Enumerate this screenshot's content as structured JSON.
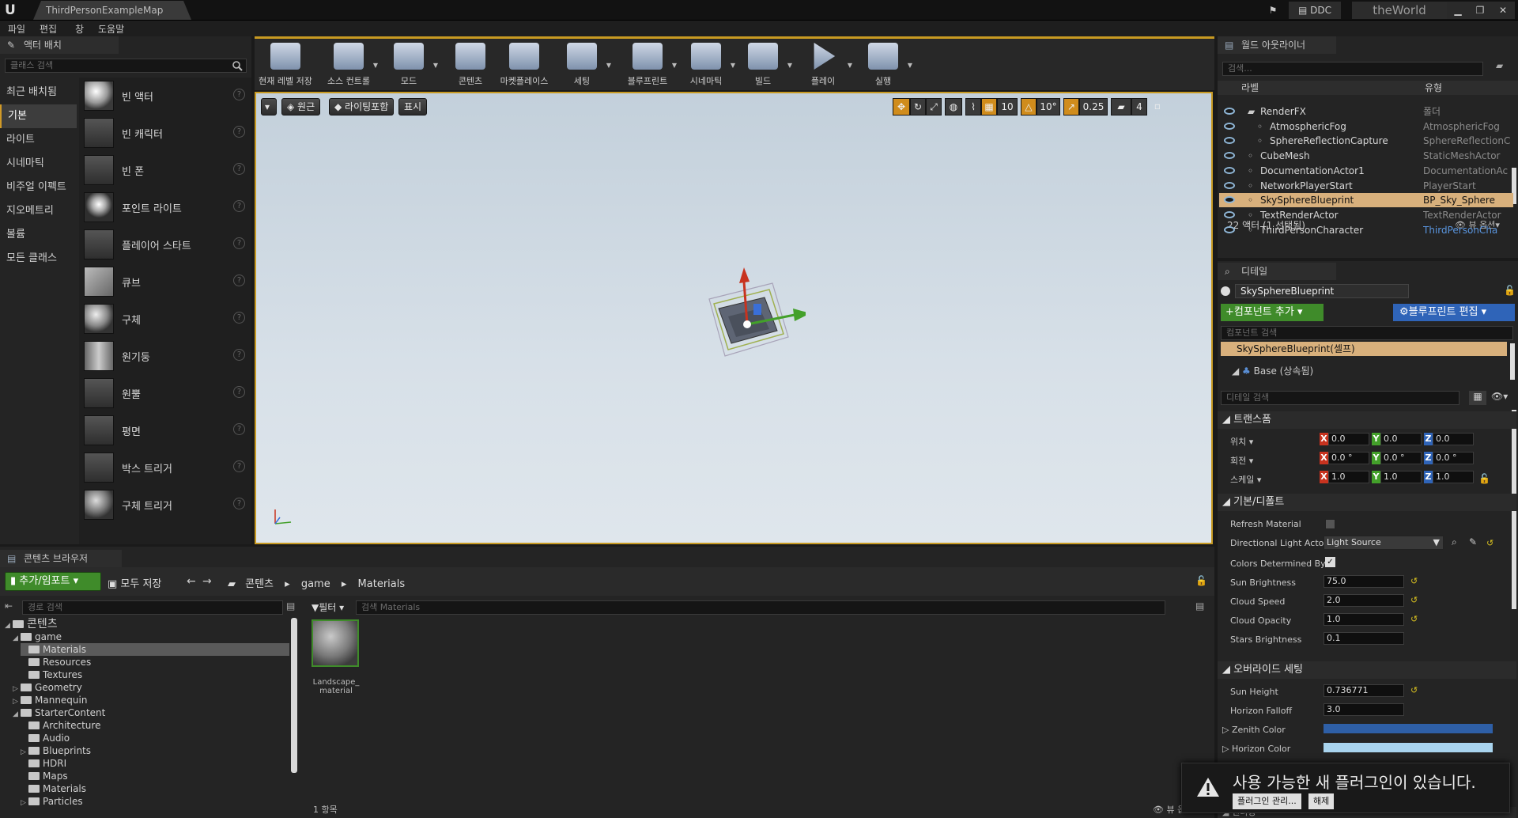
{
  "titlebar": {
    "map_tab": "ThirdPersonExampleMap",
    "ddc": "DDC",
    "world": "theWorld"
  },
  "menu": [
    "파일",
    "편집",
    "창",
    "도움말"
  ],
  "place": {
    "tab": "액터 배치",
    "search_placeholder": "클래스 검색",
    "categories": [
      "최근 배치됨",
      "기본",
      "라이트",
      "시네마틱",
      "비주얼 이펙트",
      "지오메트리",
      "볼륨",
      "모든 클래스"
    ],
    "items": [
      "빈 액터",
      "빈 캐릭터",
      "빈 폰",
      "포인트 라이트",
      "플레이어 스타트",
      "큐브",
      "구체",
      "원기둥",
      "원뿔",
      "평면",
      "박스 트리거",
      "구체 트리거"
    ]
  },
  "toolbar": [
    "현재 레벨 저장",
    "소스 컨트롤",
    "모드",
    "콘텐츠",
    "마켓플레이스",
    "세팅",
    "블루프린트",
    "시네마틱",
    "빌드",
    "플레이",
    "실행"
  ],
  "viewport": {
    "perspective": "원근",
    "lit": "라이팅포함",
    "show": "표시",
    "grid": "10",
    "angle": "10°",
    "scale": "0.25",
    "speed": "4"
  },
  "cb": {
    "tab": "콘텐츠 브라우저",
    "add": "추가/임포트",
    "save_all": "모두 저장",
    "path": [
      "콘텐츠",
      "game",
      "Materials"
    ],
    "path_search": "경로 검색",
    "filter": "필터",
    "asset_search": "검색 Materials",
    "tree": [
      {
        "label": "콘텐츠",
        "level": 0,
        "arrow": "◢"
      },
      {
        "label": "game",
        "level": 1,
        "arrow": "◢"
      },
      {
        "label": "Materials",
        "level": 2,
        "arrow": ""
      },
      {
        "label": "Resources",
        "level": 2,
        "arrow": ""
      },
      {
        "label": "Textures",
        "level": 2,
        "arrow": ""
      },
      {
        "label": "Geometry",
        "level": 1,
        "arrow": "▷"
      },
      {
        "label": "Mannequin",
        "level": 1,
        "arrow": "▷"
      },
      {
        "label": "StarterContent",
        "level": 1,
        "arrow": "◢"
      },
      {
        "label": "Architecture",
        "level": 2,
        "arrow": ""
      },
      {
        "label": "Audio",
        "level": 2,
        "arrow": ""
      },
      {
        "label": "Blueprints",
        "level": 2,
        "arrow": "▷"
      },
      {
        "label": "HDRI",
        "level": 2,
        "arrow": ""
      },
      {
        "label": "Maps",
        "level": 2,
        "arrow": ""
      },
      {
        "label": "Materials",
        "level": 2,
        "arrow": ""
      },
      {
        "label": "Particles",
        "level": 2,
        "arrow": "▷"
      }
    ],
    "asset": "Landscape_\nmaterial",
    "count": "1 항목",
    "view_options": "뷰 옵션"
  },
  "outliner": {
    "tab": "월드 아웃라이너",
    "search_placeholder": "검색...",
    "col_label": "라벨",
    "col_type": "유형",
    "rows": [
      {
        "name": "RenderFX",
        "type": "폴더",
        "indent": 0
      },
      {
        "name": "AtmosphericFog",
        "type": "AtmosphericFog",
        "indent": 1
      },
      {
        "name": "SphereReflectionCapture",
        "type": "SphereReflectionC",
        "indent": 1
      },
      {
        "name": "CubeMesh",
        "type": "StaticMeshActor",
        "indent": 0
      },
      {
        "name": "DocumentationActor1",
        "type": "DocumentationAc",
        "indent": 0
      },
      {
        "name": "NetworkPlayerStart",
        "type": "PlayerStart",
        "indent": 0
      },
      {
        "name": "SkySphereBlueprint",
        "type": "BP_Sky_Sphere",
        "indent": 0,
        "selected": true
      },
      {
        "name": "TextRenderActor",
        "type": "TextRenderActor",
        "indent": 0
      },
      {
        "name": "ThirdPersonCharacter",
        "type": "ThirdPersonCha",
        "indent": 0
      }
    ],
    "status": "22 액터 (1 선택됨)",
    "view_options": "뷰 옵션"
  },
  "details": {
    "tab": "디테일",
    "name": "SkySphereBlueprint",
    "add_component": "컴포넌트 추가",
    "edit_bp": "블루프린트 편집",
    "comp_search": "컴포넌트 검색",
    "self": "SkySphereBlueprint(셀프)",
    "base": "Base (상속됨)",
    "detail_search": "디테일 검색",
    "transform": "트랜스폼",
    "loc": "위치",
    "rot": "회전",
    "scale": "스케일",
    "loc_v": [
      "0.0",
      "0.0",
      "0.0"
    ],
    "rot_v": [
      "0.0 °",
      "0.0 °",
      "0.0 °"
    ],
    "scale_v": [
      "1.0",
      "1.0",
      "1.0"
    ],
    "default": "기본/디폴트",
    "refresh": "Refresh Material",
    "dirlight": "Directional Light Actor",
    "dirlight_v": "Light Source",
    "colors_by": "Colors Determined By",
    "sun_b": "Sun Brightness",
    "sun_b_v": "75.0",
    "cloud_s": "Cloud Speed",
    "cloud_s_v": "2.0",
    "cloud_o": "Cloud Opacity",
    "cloud_o_v": "1.0",
    "stars": "Stars Brightness",
    "stars_v": "0.1",
    "override": "오버라이드 세팅",
    "sun_h": "Sun Height",
    "sun_h_v": "0.736771",
    "hfall": "Horizon Falloff",
    "hfall_v": "3.0",
    "zenith": "Zenith Color",
    "horizon": "Horizon Color",
    "zenith_color": "#2e5fa6",
    "horizon_color": "#a9d4ee",
    "render": "렌더링"
  },
  "notify": {
    "text": "사용 가능한 새 플러그인이 있습니다.",
    "manage": "플러그인 관리...",
    "dismiss": "해제"
  }
}
